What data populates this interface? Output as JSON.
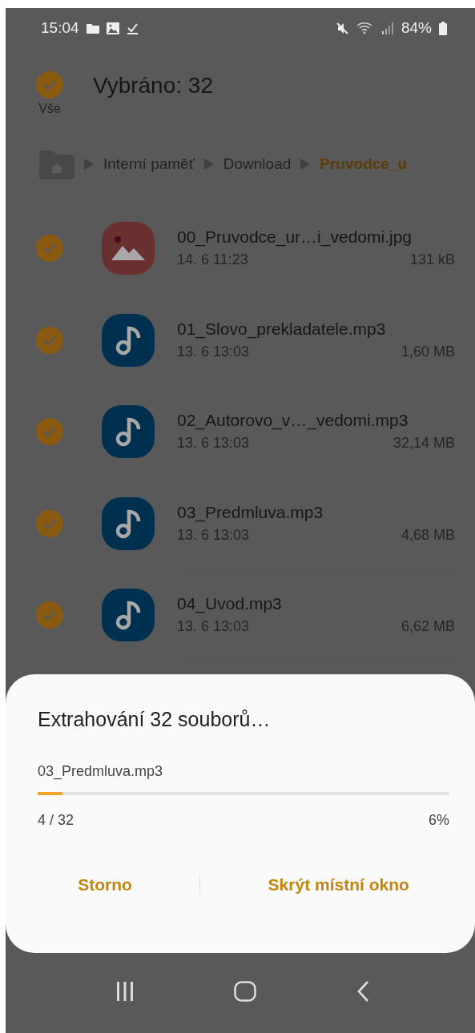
{
  "status_bar": {
    "time": "15:04",
    "battery": "84%"
  },
  "header": {
    "select_all": {
      "label": "Vše",
      "checked": true
    },
    "title": "Vybráno: 32"
  },
  "breadcrumb": [
    {
      "label": "Interní paměť",
      "selected": false
    },
    {
      "label": "Download",
      "selected": false
    },
    {
      "label": "Pruvodce_u",
      "selected": true
    }
  ],
  "files": [
    {
      "name": "00_Pruvodce_ur…i_vedomi.jpg",
      "date": "14. 6 11:23",
      "size": "131 kB",
      "kind": "image",
      "checked": true
    },
    {
      "name": "01_Slovo_prekladatele.mp3",
      "date": "13. 6 13:03",
      "size": "1,60 MB",
      "kind": "audio",
      "checked": true
    },
    {
      "name": "02_Autorovo_v…_vedomi.mp3",
      "date": "13. 6 13:03",
      "size": "32,14 MB",
      "kind": "audio",
      "checked": true
    },
    {
      "name": "03_Predmluva.mp3",
      "date": "13. 6 13:03",
      "size": "4,68 MB",
      "kind": "audio",
      "checked": true
    },
    {
      "name": "04_Uvod.mp3",
      "date": "13. 6 13:03",
      "size": "6,62 MB",
      "kind": "audio",
      "checked": true
    }
  ],
  "dialog": {
    "title": "Extrahování 32 souborů…",
    "current_file": "03_Predmluva.mp3",
    "progress": {
      "level": 0.06
    },
    "count": "4 / 32",
    "percent": "6%",
    "buttons": [
      "Storno",
      "Skrýt místní okno"
    ]
  }
}
